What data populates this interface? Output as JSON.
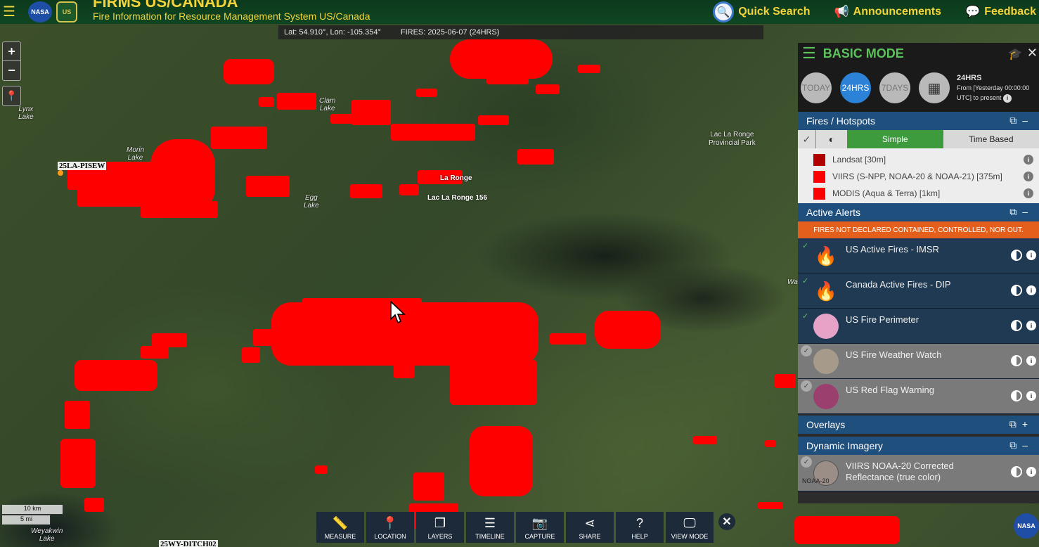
{
  "header": {
    "title": "FIRMS US/CANADA",
    "subtitle": "Fire Information for Resource Management System US/Canada",
    "logo_nasa": "NASA",
    "logo_usfs": "US",
    "nav": [
      {
        "label": "Quick Search",
        "icon": "search-icon"
      },
      {
        "label": "Announcements",
        "icon": "megaphone-icon"
      },
      {
        "label": "Feedback",
        "icon": "chat-icon"
      }
    ]
  },
  "coordbar": {
    "latlon": "Lat: 54.910°, Lon: -105.354°",
    "fires": "FIRES: 2025-06-07 (24HRS)"
  },
  "map": {
    "zoom_in": "+",
    "zoom_out": "−",
    "labels": {
      "lynx": "Lynx\nLake",
      "clam": "Clam\nLake",
      "morin": "Morin\nLake",
      "egg": "Egg\nLake",
      "weyakwin": "Weyakwin\nLake",
      "wa": "Wa",
      "laronge": "La Ronge",
      "laronge156": "Lac La Ronge 156",
      "park": "Lac La Ronge\nProvincial Park"
    },
    "fire_labels": {
      "pisew": "25LA-PISEW",
      "ditch": "25WY-DITCH02"
    },
    "scale_km": "10 km",
    "scale_mi": "5 mi"
  },
  "toolbar": [
    {
      "label": "MEASURE",
      "icon": "ruler-icon",
      "glyph": "📏"
    },
    {
      "label": "LOCATION",
      "icon": "pin-icon",
      "glyph": "📍"
    },
    {
      "label": "LAYERS",
      "icon": "layers-icon",
      "glyph": "❐"
    },
    {
      "label": "TIMELINE",
      "icon": "sliders-icon",
      "glyph": "☰"
    },
    {
      "label": "CAPTURE",
      "icon": "camera-icon",
      "glyph": "📷"
    },
    {
      "label": "SHARE",
      "icon": "share-icon",
      "glyph": "⋖"
    },
    {
      "label": "HELP",
      "icon": "help-icon",
      "glyph": "?"
    },
    {
      "label": "VIEW MODE",
      "icon": "monitor-icon",
      "glyph": "🖵"
    }
  ],
  "toolbar_close": "✕",
  "nasa_corner": "NASA",
  "panel": {
    "title": "BASIC MODE",
    "time_buttons": [
      "TODAY",
      "24HRS",
      "7DAYS"
    ],
    "time_active": "24HRS",
    "time_title": "24HRS",
    "time_desc1": "From [Yesterday 00:00:00",
    "time_desc2": "UTC] to present",
    "fires_section": "Fires / Hotspots",
    "tab_simple": "Simple",
    "tab_time": "Time Based",
    "fire_sources": [
      {
        "label": "Landsat [30m]",
        "color": "#b00000"
      },
      {
        "label": "VIIRS (S-NPP, NOAA-20 & NOAA-21) [375m]",
        "color": "#ff0000"
      },
      {
        "label": "MODIS (Aqua & Terra) [1km]",
        "color": "#ff0000"
      }
    ],
    "alerts_section": "Active Alerts",
    "alerts_banner": "FIRES NOT DECLARED CONTAINED, CONTROLLED, NOR OUT.",
    "alerts": [
      {
        "label": "US Active Fires - IMSR",
        "checked": true,
        "icon": "flame-icon",
        "color": "#f07a1a"
      },
      {
        "label": "Canada Active Fires - DIP",
        "checked": true,
        "icon": "flame-icon",
        "color": "#f07a1a"
      },
      {
        "label": "US Fire Perimeter",
        "checked": true,
        "icon": "circle-icon",
        "color": "#e7a2c8"
      },
      {
        "label": "US Fire Weather Watch",
        "checked": false,
        "icon": "circle-icon",
        "color": "#a69a8a"
      },
      {
        "label": "US Red Flag Warning",
        "checked": false,
        "icon": "circle-icon",
        "color": "#9a3f6e"
      }
    ],
    "overlays_section": "Overlays",
    "imagery_section": "Dynamic Imagery",
    "imagery_label": "VIIRS NOAA-20 Corrected\nReflectance (true color)",
    "imagery_tag": "NOAA-20"
  }
}
